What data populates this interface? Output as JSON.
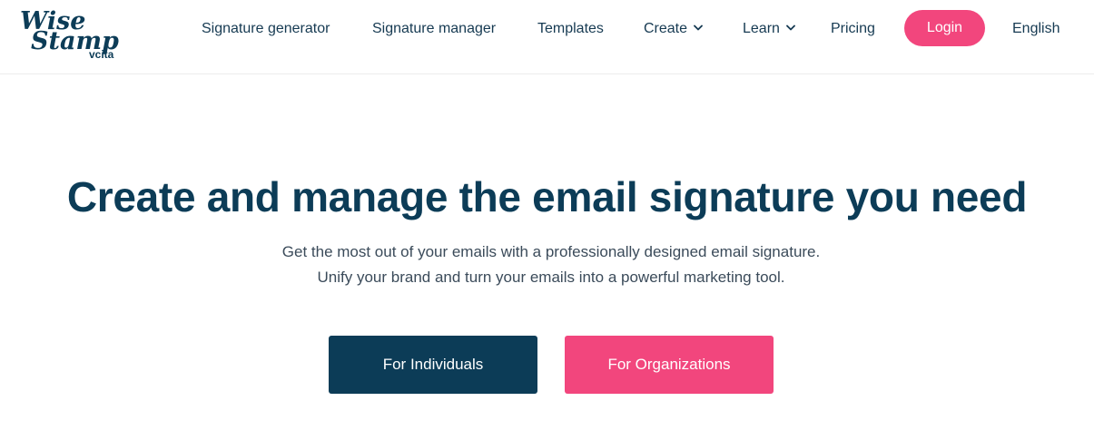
{
  "brand": {
    "logo_line1": "Wise",
    "logo_line2": "Stamp",
    "logo_tag": "vcita"
  },
  "nav": {
    "items": [
      {
        "label": "Signature generator"
      },
      {
        "label": "Signature manager"
      },
      {
        "label": "Templates"
      },
      {
        "label": "Create",
        "icon": "chevron-down-icon"
      },
      {
        "label": "Learn",
        "icon": "chevron-down-icon"
      },
      {
        "label": "Pricing"
      }
    ],
    "login_label": "Login",
    "language_label": "English"
  },
  "hero": {
    "title": "Create and manage the email signature you need",
    "subtitle_line1": "Get the most out of your emails with a professionally designed email signature.",
    "subtitle_line2": "Unify your brand and turn your emails into a powerful marketing tool."
  },
  "cta": {
    "individuals_label": "For Individuals",
    "organizations_label": "For Organizations"
  },
  "colors": {
    "navy": "#0c3c57",
    "pink": "#f2467d",
    "white": "#ffffff"
  }
}
